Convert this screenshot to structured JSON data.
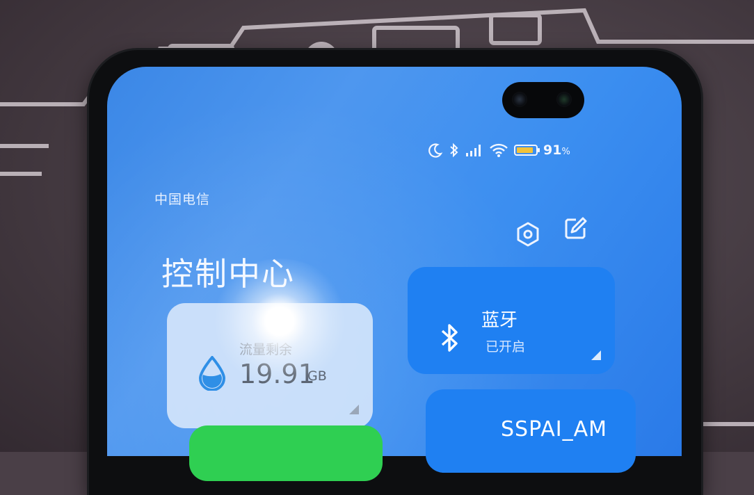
{
  "status_bar": {
    "carrier": "中国电信",
    "battery_text": "91",
    "battery_unit": "%",
    "battery_level": 0.91,
    "icons": [
      "moon-icon",
      "bluetooth-icon",
      "signal-icon",
      "wifi-icon",
      "battery-icon"
    ]
  },
  "header": {
    "title": "控制中心",
    "settings_icon": "settings-hexagon-icon",
    "edit_icon": "edit-icon"
  },
  "tiles": {
    "data": {
      "label": "流量剩余",
      "value": "19.91",
      "unit": "GB",
      "icon": "water-drop-icon"
    },
    "bluetooth": {
      "name": "蓝牙",
      "state": "已开启",
      "icon": "bluetooth-icon"
    },
    "wifi": {
      "ssid": "SSPAI_AM"
    }
  },
  "colors": {
    "tile_active": "#1f80f2",
    "tile_green": "#2fcf52",
    "battery_fill": "#f2c23a",
    "screen_bg": "#3b87e6"
  }
}
